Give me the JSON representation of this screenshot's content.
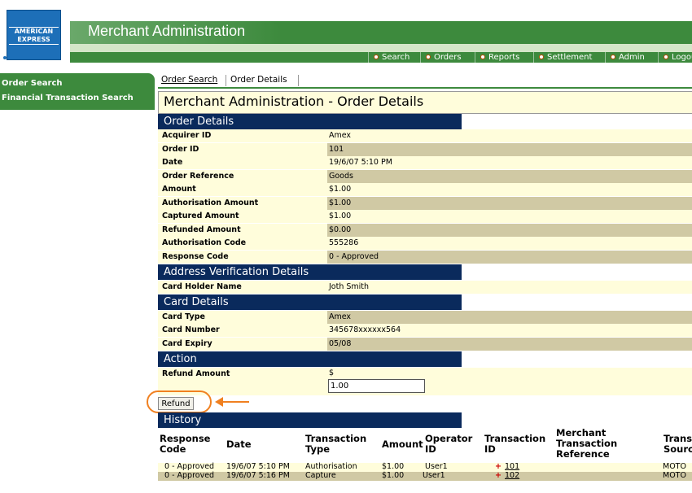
{
  "header": {
    "logo_text": "AMERICAN EXPRESS",
    "app_title": "Merchant Administration",
    "nav": [
      "Search",
      "Orders",
      "Reports",
      "Settlement",
      "Admin",
      "Logout"
    ]
  },
  "sidebar": {
    "items": [
      {
        "label": "Order Search"
      },
      {
        "label": "Financial Transaction Search"
      }
    ]
  },
  "tabs": [
    {
      "label": "Order Search"
    },
    {
      "label": "Order Details"
    }
  ],
  "page_title": "Merchant Administration - Order Details",
  "order_details": {
    "title": "Order Details",
    "rows": [
      {
        "label": "Acquirer ID",
        "value": "Amex"
      },
      {
        "label": "Order ID",
        "value": "101"
      },
      {
        "label": "Date",
        "value": "19/6/07 5:10 PM"
      },
      {
        "label": "Order Reference",
        "value": "Goods"
      },
      {
        "label": "Amount",
        "value": "$1.00"
      },
      {
        "label": "Authorisation Amount",
        "value": "$1.00"
      },
      {
        "label": "Captured Amount",
        "value": "$1.00"
      },
      {
        "label": "Refunded Amount",
        "value": "$0.00"
      },
      {
        "label": "Authorisation Code",
        "value": "555286"
      },
      {
        "label": "Response Code",
        "value": "0 - Approved"
      }
    ]
  },
  "address_verification": {
    "title": "Address Verification Details",
    "rows": [
      {
        "label": "Card Holder Name",
        "value": "Joth Smith"
      }
    ]
  },
  "card_details": {
    "title": "Card Details",
    "rows": [
      {
        "label": "Card Type",
        "value": "Amex"
      },
      {
        "label": "Card Number",
        "value": "345678xxxxxx564"
      },
      {
        "label": "Card Expiry",
        "value": "05/08"
      }
    ]
  },
  "action": {
    "title": "Action",
    "refund_label": "Refund Amount",
    "currency": "$",
    "refund_value": "1.00",
    "refund_button": "Refund"
  },
  "history": {
    "title": "History",
    "columns": [
      "Response Code",
      "Date",
      "Transaction Type",
      "Amount",
      "Operator ID",
      "Transaction ID",
      "Merchant Transaction Reference",
      "Transaction Source"
    ],
    "rows": [
      {
        "response_code": "0 - Approved",
        "date": "19/6/07 5:10 PM",
        "type": "Authorisation",
        "amount": "$1.00",
        "operator": "User1",
        "txn_id": "101",
        "merchant_ref": "",
        "source": "MOTO"
      },
      {
        "response_code": "0 - Approved",
        "date": "19/6/07 5:16 PM",
        "type": "Capture",
        "amount": "$1.00",
        "operator": "User1",
        "txn_id": "102",
        "merchant_ref": "",
        "source": "MOTO"
      }
    ]
  },
  "colors": {
    "brand_green": "#3d8a3d",
    "section_navy": "#0a2a5c",
    "row_light": "#fffddb",
    "row_dark": "#d0c9a4",
    "highlight_orange": "#f08020"
  }
}
